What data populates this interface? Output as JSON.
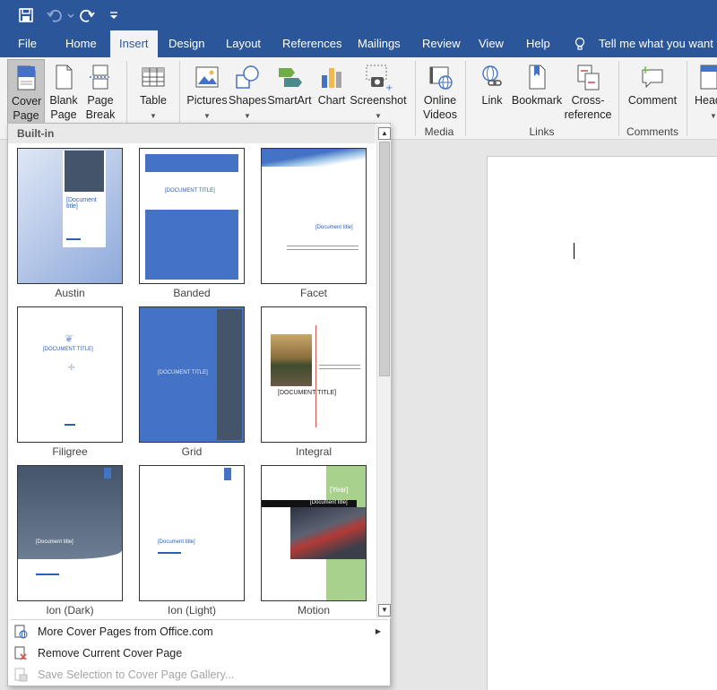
{
  "tabs": [
    "File",
    "Home",
    "Insert",
    "Design",
    "Layout",
    "References",
    "Mailings",
    "Review",
    "View",
    "Help"
  ],
  "tell_me": "Tell me what you want to",
  "ribbon": {
    "cover_page": "Cover Page",
    "blank_page": "Blank Page",
    "page_break": "Page Break",
    "table": "Table",
    "pictures": "Pictures",
    "shapes": "Shapes",
    "smartart": "SmartArt",
    "chart": "Chart",
    "screenshot": "Screenshot",
    "online_videos": "Online Videos",
    "link": "Link",
    "bookmark": "Bookmark",
    "cross_reference": "Cross-reference",
    "comment": "Comment",
    "header": "Head",
    "groups": {
      "media": "Media",
      "links": "Links",
      "comments": "Comments"
    }
  },
  "gallery": {
    "header": "Built-in",
    "items": [
      "Austin",
      "Banded",
      "Facet",
      "Filigree",
      "Grid",
      "Integral",
      "Ion (Dark)",
      "Ion (Light)",
      "Motion"
    ],
    "placeholders": {
      "doc_title_lower": "[Document title]",
      "doc_title_upper": "[DOCUMENT TITLE]",
      "doc_title_wrapped": "[Document title]",
      "year": "[Year]"
    }
  },
  "menu": {
    "more": "More Cover Pages from Office.com",
    "remove": "Remove Current Cover Page",
    "save": "Save Selection to Cover Page Gallery..."
  },
  "colors": {
    "brand": "#2b579a",
    "accent": "#4472c4",
    "green": "#a9d18e",
    "slate": "#44546a"
  }
}
